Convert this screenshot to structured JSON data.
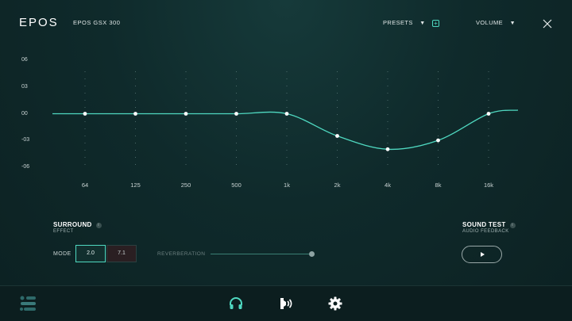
{
  "header": {
    "logo": "EPOS",
    "device": "EPOS GSX 300",
    "presets_label": "PRESETS",
    "presets_caret": "▼",
    "add_preset": "+",
    "volume_label": "VOLUME",
    "volume_caret": "▼"
  },
  "colors": {
    "accent": "#4fd8c0",
    "background": "#0f2a2b",
    "curve": "#4fd8c0"
  },
  "equalizer": {
    "y_labels": [
      "06",
      "03",
      "00",
      "-03",
      "-06"
    ],
    "bands": [
      {
        "label": "64",
        "gain_db": 0
      },
      {
        "label": "125",
        "gain_db": 0
      },
      {
        "label": "250",
        "gain_db": 0
      },
      {
        "label": "500",
        "gain_db": 0
      },
      {
        "label": "1k",
        "gain_db": 0
      },
      {
        "label": "2k",
        "gain_db": -2.5
      },
      {
        "label": "4k",
        "gain_db": -4.0
      },
      {
        "label": "8k",
        "gain_db": -3.0
      },
      {
        "label": "16k",
        "gain_db": 0
      }
    ]
  },
  "surround": {
    "title": "SURROUND",
    "info": "i",
    "subtitle": "EFFECT",
    "mode_label": "MODE",
    "modes": [
      "2.0",
      "7.1"
    ],
    "selected_mode": "2.0",
    "reverb_label": "REVERBERATION",
    "reverb_level": 1.0
  },
  "sound_test": {
    "title": "SOUND TEST",
    "info": "i",
    "subtitle": "AUDIO FEEDBACK"
  },
  "nav": {
    "menu_icon": "menu-icon",
    "items": [
      "headphones-icon",
      "sidetone-icon",
      "gear-icon"
    ],
    "active": "headphones-icon"
  }
}
